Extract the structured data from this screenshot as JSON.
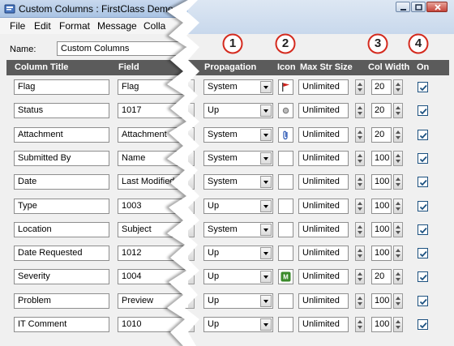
{
  "window": {
    "title": "Custom Columns : FirstClass Demo",
    "colors": {
      "header_band": "#5b5b5b",
      "titlebar": "#a9c3e3",
      "check": "#1c5180",
      "flag_red": "#d0201a",
      "attach_blue": "#2a57b5",
      "severity_green": "#3a8a2a"
    }
  },
  "menu": [
    "File",
    "Edit",
    "Format",
    "Message",
    "Colla"
  ],
  "form": {
    "name_label": "Name:",
    "name_value": "Custom Columns"
  },
  "left_headers": {
    "column_title": "Column Title",
    "field": "Field"
  },
  "right_headers": {
    "propagation": "Propagation",
    "icon": "Icon",
    "max_str_size": "Max Str Size",
    "col_width": "Col Width",
    "on": "On"
  },
  "callouts": [
    "1",
    "2",
    "3",
    "4"
  ],
  "rows": [
    {
      "title": "Flag",
      "field": "Flag",
      "propagation": "System",
      "icon": "flag-icon",
      "max_str": "Unlimited",
      "width": "20",
      "on": true
    },
    {
      "title": "Status",
      "field": "1017",
      "propagation": "Up",
      "icon": "status-dot-icon",
      "max_str": "Unlimited",
      "width": "20",
      "on": true
    },
    {
      "title": "Attachment",
      "field": "Attachment",
      "propagation": "System",
      "icon": "paperclip-icon",
      "max_str": "Unlimited",
      "width": "20",
      "on": true
    },
    {
      "title": "Submitted By",
      "field": "Name",
      "propagation": "System",
      "icon": "",
      "max_str": "Unlimited",
      "width": "100",
      "on": true
    },
    {
      "title": "Date",
      "field": "Last Modified",
      "propagation": "System",
      "icon": "",
      "max_str": "Unlimited",
      "width": "100",
      "on": true
    },
    {
      "title": "Type",
      "field": "1003",
      "propagation": "Up",
      "icon": "",
      "max_str": "Unlimited",
      "width": "100",
      "on": true
    },
    {
      "title": "Location",
      "field": "Subject",
      "propagation": "System",
      "icon": "",
      "max_str": "Unlimited",
      "width": "100",
      "on": true
    },
    {
      "title": "Date Requested",
      "field": "1012",
      "propagation": "Up",
      "icon": "",
      "max_str": "Unlimited",
      "width": "100",
      "on": true
    },
    {
      "title": "Severity",
      "field": "1004",
      "propagation": "Up",
      "icon": "severity-icon",
      "max_str": "Unlimited",
      "width": "20",
      "on": true
    },
    {
      "title": "Problem",
      "field": "Preview",
      "propagation": "Up",
      "icon": "",
      "max_str": "Unlimited",
      "width": "100",
      "on": true
    },
    {
      "title": "IT Comment",
      "field": "1010",
      "propagation": "Up",
      "icon": "",
      "max_str": "Unlimited",
      "width": "100",
      "on": true
    }
  ]
}
